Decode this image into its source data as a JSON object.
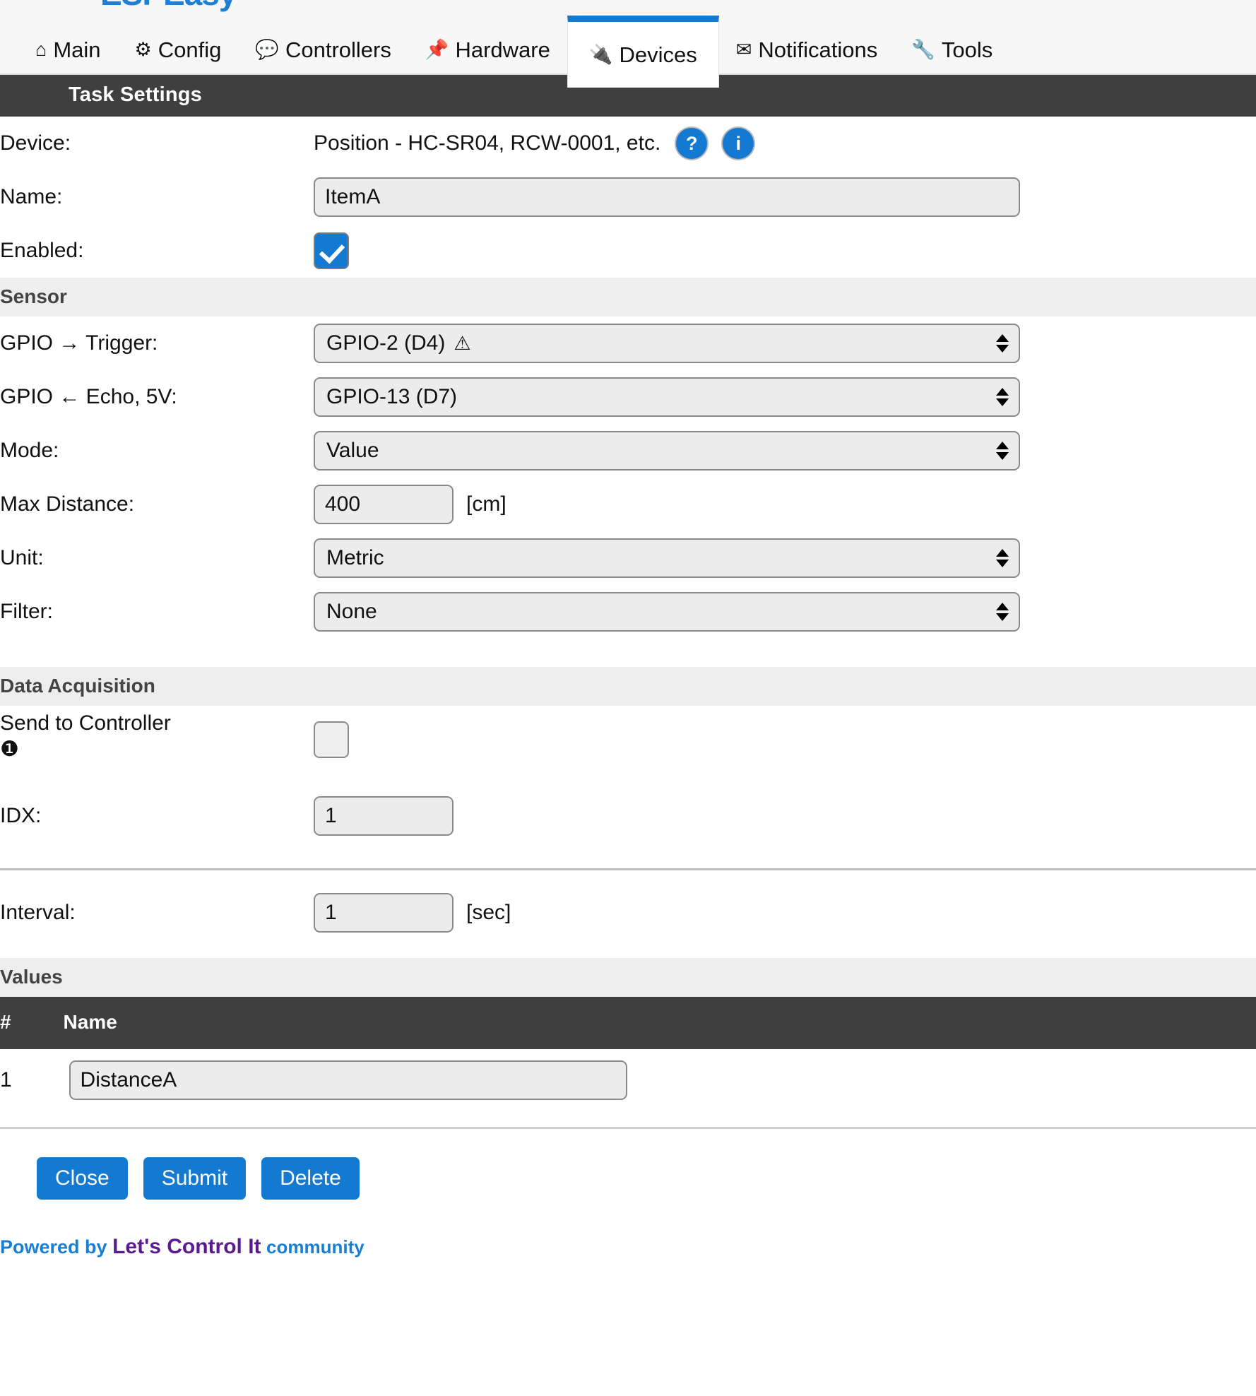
{
  "brand": {
    "logo_text": "ESPEasy"
  },
  "nav": {
    "tabs": [
      {
        "label": "Main",
        "icon": "home-icon",
        "glyph": "⌂",
        "active": false
      },
      {
        "label": "Config",
        "icon": "gear-icon",
        "glyph": "⚙",
        "active": false
      },
      {
        "label": "Controllers",
        "icon": "speech-bubble-icon",
        "glyph": "💬",
        "active": false
      },
      {
        "label": "Hardware",
        "icon": "pushpin-icon",
        "glyph": "📌",
        "active": false
      },
      {
        "label": "Devices",
        "icon": "plug-icon",
        "glyph": "🔌",
        "active": true
      },
      {
        "label": "Notifications",
        "icon": "envelope-icon",
        "glyph": "✉",
        "active": false
      },
      {
        "label": "Tools",
        "icon": "wrench-icon",
        "glyph": "🔧",
        "active": false
      }
    ]
  },
  "task_settings": {
    "title": "Task Settings",
    "device": {
      "label": "Device:",
      "value": "Position - HC-SR04, RCW-0001, etc.",
      "help_badge": "?",
      "info_badge": "i"
    },
    "name": {
      "label": "Name:",
      "value": "ItemA"
    },
    "enabled": {
      "label": "Enabled:",
      "checked": true
    }
  },
  "sensor": {
    "title": "Sensor",
    "gpio_trigger": {
      "label": "GPIO → Trigger:",
      "value": "GPIO-2 (D4)",
      "warning": "⚠"
    },
    "gpio_echo": {
      "label": "GPIO ← Echo, 5V:",
      "value": "GPIO-13 (D7)"
    },
    "mode": {
      "label": "Mode:",
      "value": "Value"
    },
    "max_distance": {
      "label": "Max Distance:",
      "value": "400",
      "unit": "[cm]"
    },
    "unit": {
      "label": "Unit:",
      "value": "Metric"
    },
    "filter": {
      "label": "Filter:",
      "value": "None"
    }
  },
  "data_acquisition": {
    "title": "Data Acquisition",
    "send_to_controller": {
      "label": "Send to Controller",
      "badge": "❶",
      "checked": false
    },
    "idx": {
      "label": "IDX:",
      "value": "1"
    },
    "interval": {
      "label": "Interval:",
      "value": "1",
      "unit": "[sec]"
    }
  },
  "values": {
    "title": "Values",
    "columns": [
      "#",
      "Name"
    ],
    "rows": [
      {
        "index": "1",
        "name": "DistanceA"
      }
    ]
  },
  "actions": {
    "close": "Close",
    "submit": "Submit",
    "delete": "Delete"
  },
  "footer": {
    "powered_by": "Powered by",
    "brand": "Let's Control It",
    "suffix": "community"
  },
  "colors": {
    "accent": "#1479d1",
    "bar_dark": "#3f3f3f",
    "bar_light": "#eeeeee",
    "brand_purple": "#5b1a8f"
  }
}
